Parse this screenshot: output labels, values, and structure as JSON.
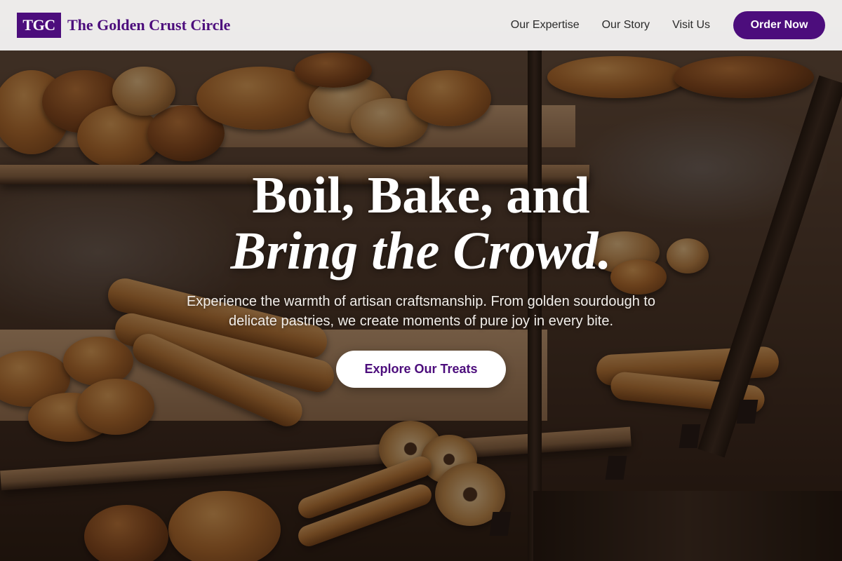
{
  "brand": {
    "logo_text": "TGC",
    "name": "The Golden Crust Circle"
  },
  "nav": {
    "links": [
      {
        "label": "Our Expertise"
      },
      {
        "label": "Our Story"
      },
      {
        "label": "Visit Us"
      }
    ],
    "cta_label": "Order Now"
  },
  "hero": {
    "headline_line1": "Boil, Bake, and",
    "headline_line2": "Bring the Crowd.",
    "subtext": "Experience the warmth of artisan craftsmanship. From golden sourdough to delicate pastries, we create moments of pure joy in every bite.",
    "cta_label": "Explore Our Treats",
    "background_image": "bakery-display-case"
  },
  "colors": {
    "brand_purple": "#4c0d7c",
    "nav_background": "#f8f6f6",
    "white": "#ffffff"
  }
}
